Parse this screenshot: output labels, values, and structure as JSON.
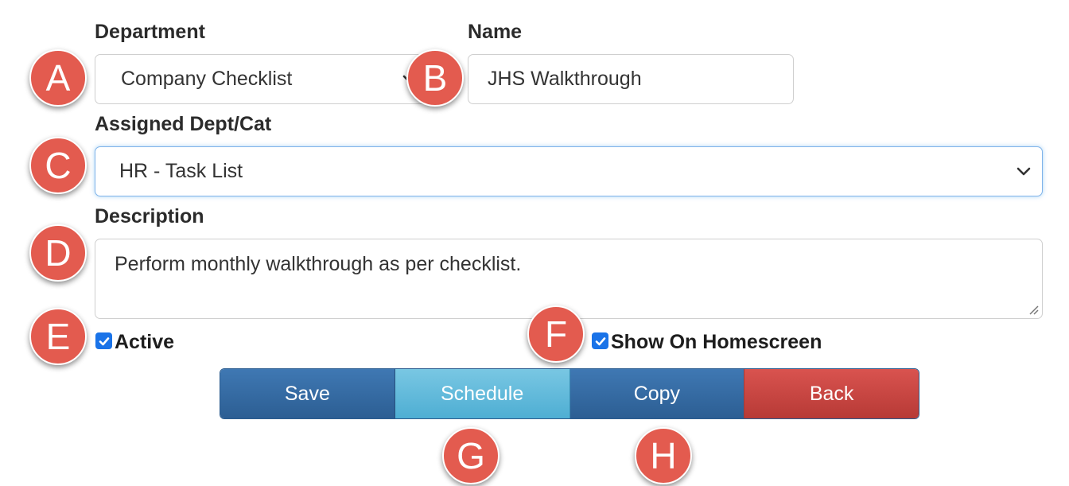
{
  "form": {
    "department": {
      "label": "Department",
      "value": "Company Checklist"
    },
    "name": {
      "label": "Name",
      "value": "JHS Walkthrough"
    },
    "assigned": {
      "label": "Assigned Dept/Cat",
      "value": "HR - Task List"
    },
    "description": {
      "label": "Description",
      "value": "Perform monthly walkthrough as per checklist."
    },
    "active": {
      "label": "Active",
      "checked": true
    },
    "show_home": {
      "label": "Show On Homescreen",
      "checked": true
    }
  },
  "buttons": {
    "save": "Save",
    "schedule": "Schedule",
    "copy": "Copy",
    "back": "Back"
  },
  "markers": [
    "A",
    "B",
    "C",
    "D",
    "E",
    "F",
    "G",
    "H"
  ],
  "colors": {
    "primary": "#2c5e93",
    "info": "#5bc0de",
    "danger": "#c9302c",
    "checkbox": "#1a73e8",
    "marker": "#e35b4f"
  }
}
